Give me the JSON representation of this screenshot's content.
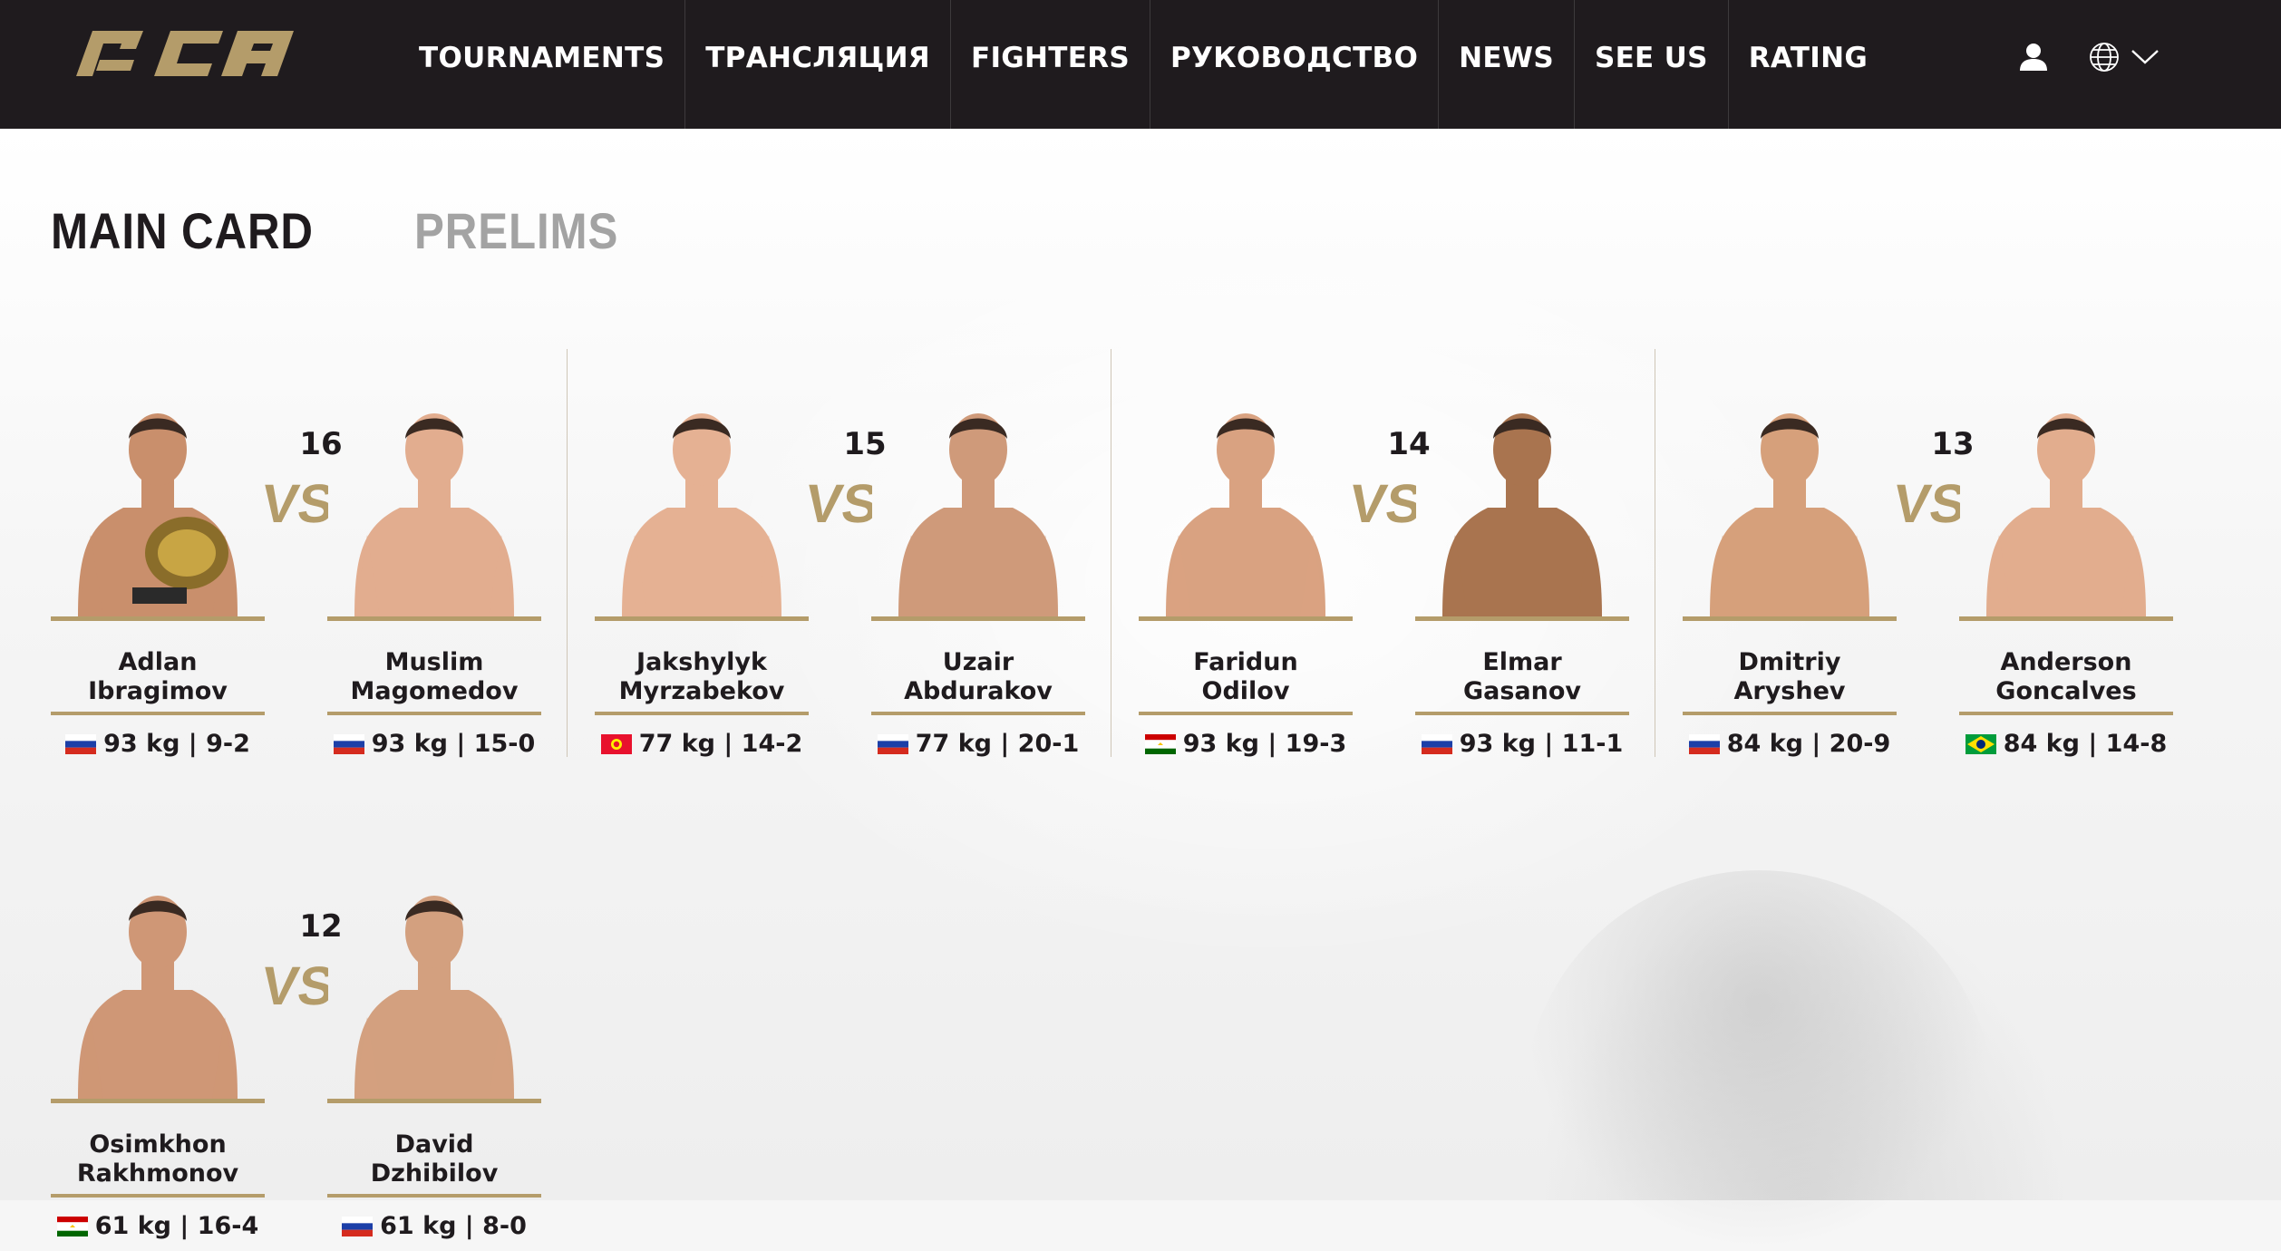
{
  "nav": {
    "logo_text": "ACA",
    "items": [
      "TOURNAMENTS",
      "ТРАНСЛЯЦИЯ",
      "FIGHTERS",
      "РУКОВОДСТВО",
      "NEWS",
      "SEE US",
      "RATING"
    ]
  },
  "tabs": {
    "main": "MAIN CARD",
    "prelims": "PRELIMS"
  },
  "colors": {
    "gold": "#b49c6a",
    "dark": "#1f1b1e",
    "inactive_tab": "#a3a3a3"
  },
  "bouts": [
    {
      "number": "16",
      "vs": "VS",
      "f1": {
        "first": "Adlan",
        "last": "Ibragimov",
        "flag": "russia",
        "weight": "93 kg",
        "record": "9-2"
      },
      "f2": {
        "first": "Muslim",
        "last": "Magomedov",
        "flag": "russia",
        "weight": "93 kg",
        "record": "15-0"
      }
    },
    {
      "number": "15",
      "vs": "VS",
      "f1": {
        "first": "Jakshylyk",
        "last": "Myrzabekov",
        "flag": "kyrgyzstan",
        "weight": "77 kg",
        "record": "14-2"
      },
      "f2": {
        "first": "Uzair",
        "last": "Abdurakov",
        "flag": "russia",
        "weight": "77 kg",
        "record": "20-1"
      }
    },
    {
      "number": "14",
      "vs": "VS",
      "f1": {
        "first": "Faridun",
        "last": "Odilov",
        "flag": "tajikistan",
        "weight": "93 kg",
        "record": "19-3"
      },
      "f2": {
        "first": "Elmar",
        "last": "Gasanov",
        "flag": "russia",
        "weight": "93 kg",
        "record": "11-1"
      }
    },
    {
      "number": "13",
      "vs": "VS",
      "f1": {
        "first": "Dmitriy",
        "last": "Aryshev",
        "flag": "russia",
        "weight": "84 kg",
        "record": "20-9"
      },
      "f2": {
        "first": "Anderson",
        "last": "Goncalves",
        "flag": "brazil",
        "weight": "84 kg",
        "record": "14-8"
      }
    },
    {
      "number": "12",
      "vs": "VS",
      "f1": {
        "first": "Osimkhon",
        "last": "Rakhmonov",
        "flag": "tajikistan",
        "weight": "61 kg",
        "record": "16-4"
      },
      "f2": {
        "first": "David",
        "last": "Dzhibilov",
        "flag": "russia",
        "weight": "61 kg",
        "record": "8-0"
      }
    }
  ]
}
